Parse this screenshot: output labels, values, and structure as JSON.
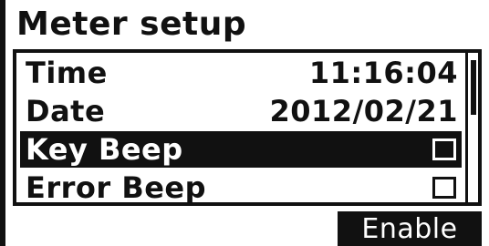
{
  "title": "Meter setup",
  "menu": {
    "items": [
      {
        "label": "Time",
        "value": "11:16:04",
        "kind": "value"
      },
      {
        "label": "Date",
        "value": "2012/02/21",
        "kind": "value"
      },
      {
        "label": "Key Beep",
        "kind": "checkbox",
        "checked": false,
        "selected": true
      },
      {
        "label": "Error Beep",
        "kind": "checkbox",
        "checked": false,
        "selected": false
      }
    ]
  },
  "softkey": {
    "right_label": "Enable"
  },
  "colors": {
    "foreground": "#111111",
    "background": "#ffffff"
  }
}
